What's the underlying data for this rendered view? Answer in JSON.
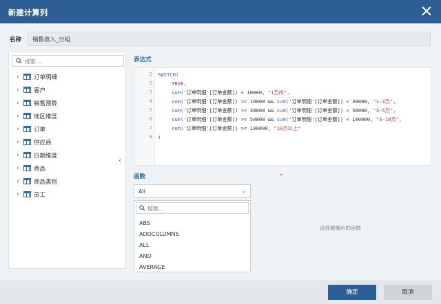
{
  "dialog": {
    "title": "新建计算列"
  },
  "name": {
    "label": "名称",
    "value": "销售收入_分组"
  },
  "tree": {
    "search_placeholder": "搜索...",
    "items": [
      {
        "label": "订单明细"
      },
      {
        "label": "客户"
      },
      {
        "label": "销售预算"
      },
      {
        "label": "地区维度"
      },
      {
        "label": "订单"
      },
      {
        "label": "供应商"
      },
      {
        "label": "日期维度"
      },
      {
        "label": "商品"
      },
      {
        "label": "商品类别"
      },
      {
        "label": "员工"
      }
    ]
  },
  "expression": {
    "label": "表达式",
    "line_numbers": [
      "1",
      "2",
      "3",
      "4",
      "5",
      "6",
      "7",
      "8"
    ],
    "code": {
      "l1_kw": "SWITCH(",
      "l2_kw": "TRUE,",
      "l3_fn": "sum(",
      "l3_mid": "'订单明细'[订单金额]) < 10000, ",
      "l3_str": "\"1万内\",",
      "l4_fn": "sum(",
      "l4_mid": "'订单明细'[订单金额]) >= 10000 && ",
      "l4_fn2": "sum(",
      "l4_mid2": "'订单明细'[订单金额]) < 30000, ",
      "l4_str": "\"1-3万\",",
      "l5_fn": "sum(",
      "l5_mid": "'订单明细'[订单金额]) >= 30000 && ",
      "l5_fn2": "sum(",
      "l5_mid2": "'订单明细'[订单金额]) < 50000, ",
      "l5_str": "\"3-5万\",",
      "l6_fn": "sum(",
      "l6_mid": "'订单明细'[订单金额]) >= 50000 && ",
      "l6_fn2": "sum(",
      "l6_mid2": "'订单明细'[订单金额]) < 100000, ",
      "l6_str": "\"5-10万\",",
      "l7_fn": "sum(",
      "l7_mid": "'订单明细'[订单金额]) >= 100000, ",
      "l7_str": "\"10万以上\"",
      "l8": ")"
    }
  },
  "functions": {
    "label": "函数",
    "category_selected": "All",
    "search_placeholder": "搜索...",
    "items": [
      "ABS",
      "ADDCOLUMNS",
      "ALL",
      "AND",
      "AVERAGE"
    ],
    "hint": "选择要展示的函数"
  },
  "footer": {
    "ok_label": "确定",
    "cancel_label": "取消"
  },
  "colors": {
    "primary": "#2e5f94",
    "keyword": "#3b5bdb",
    "string": "#c0392b"
  }
}
